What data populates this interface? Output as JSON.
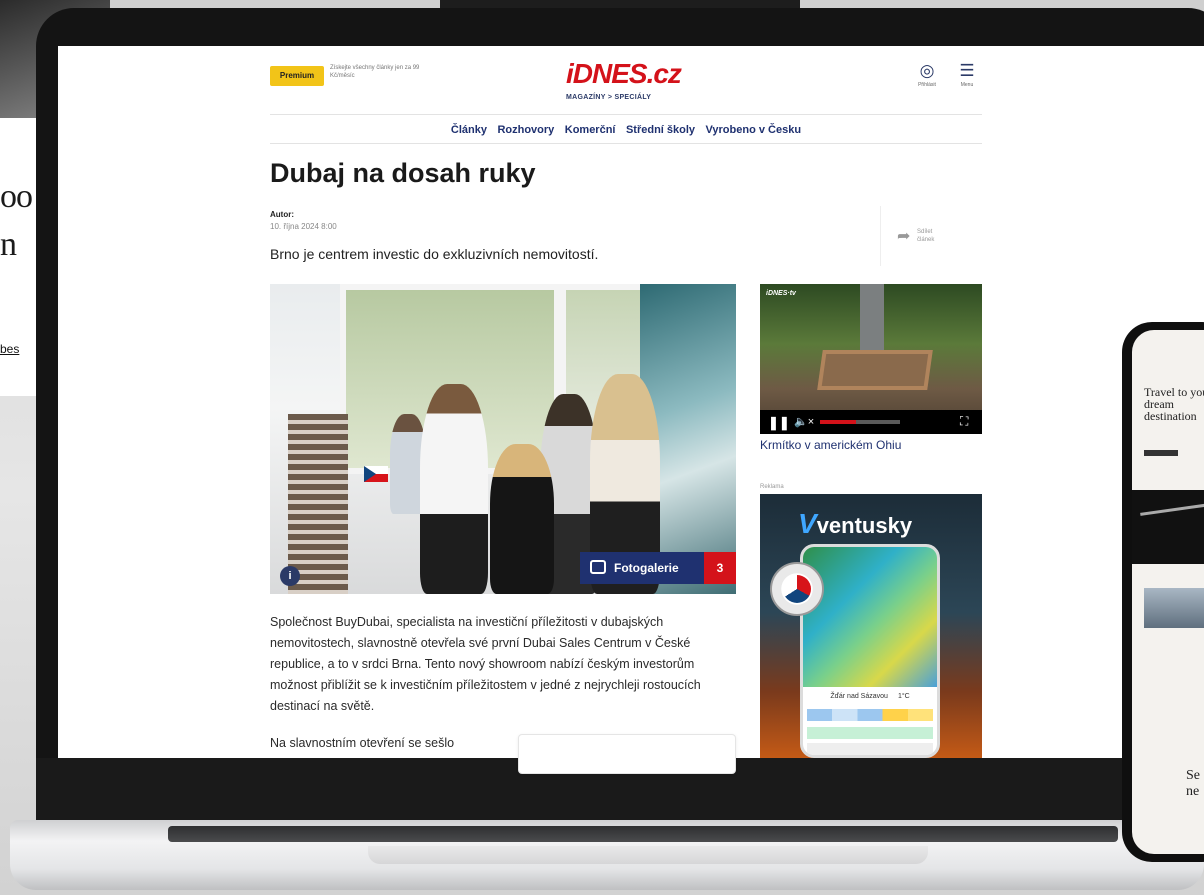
{
  "background": {
    "left_card_lines": [
      "oo",
      "n",
      "bes"
    ]
  },
  "site": {
    "premium": {
      "badge": "Premium",
      "text": "Získejte všechny články jen za 99 Kč/měsíc"
    },
    "logo": "iDNES.cz",
    "logo_sub": "MAGAZÍNY > SPECIÁLY",
    "header_icons": {
      "login_label": "Přihlásit",
      "menu_label": "Menu"
    },
    "nav": [
      "Články",
      "Rozhovory",
      "Komerční",
      "Střední školy",
      "Vyrobeno v Česku"
    ]
  },
  "article": {
    "title": "Dubaj na dosah ruky",
    "author_label": "Autor:",
    "date": "10. října 2024  8:00",
    "share_label": "Sdílet článek",
    "perex": "Brno je centrem investic do exkluzivních nemovitostí.",
    "gallery_label": "Fotogalerie",
    "gallery_count": "3",
    "body": "Společnost BuyDubai, specialista na investiční příležitosti v dubajských nemovitostech, slavnostně otevřela své první Dubai Sales Centrum v České republice, a to v srdci Brna. Tento nový showroom nabízí českým investorům možnost přiblížit se k investičním příležitostem v jedné z nejrychleji rostoucích destinací na světě.",
    "body_cont": "Na slavnostním otevření se sešlo"
  },
  "video": {
    "logo": "iDNES·tv",
    "caption": "Krmítko v americkém Ohiu",
    "progress": 0.45
  },
  "ad": {
    "label": "Reklama",
    "brand": "ventusky",
    "city": "Žďár nad Sázavou",
    "temperature": "1°C"
  },
  "phone": {
    "title": "Travel to your dream destination",
    "bottom": "Se ne"
  }
}
